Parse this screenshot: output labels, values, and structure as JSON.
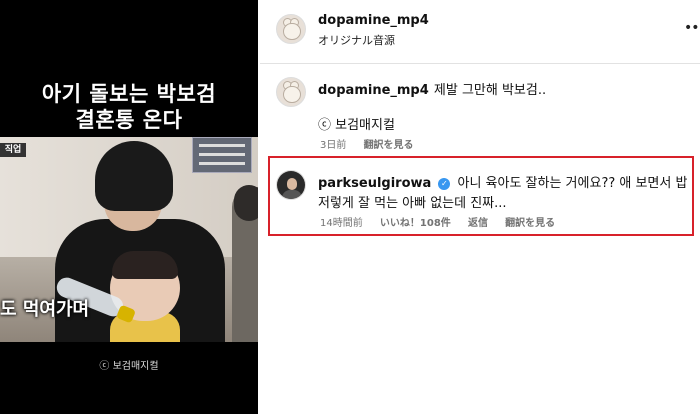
{
  "video": {
    "caption_line1": "아기 돌보는 박보검",
    "caption_line2": "결혼통 온다",
    "subtitle": "도 먹여가며",
    "watermark": "ⓒ 보검매지컬",
    "corner_badge": "직업"
  },
  "post": {
    "username": "dopamine_mp4",
    "audio": "オリジナル音源",
    "more_icon": "•••"
  },
  "comments": [
    {
      "username": "dopamine_mp4",
      "text": "제발 그만해 박보검..",
      "credit": "ⓒ 보검매지컬",
      "time": "3日前",
      "translate": "翻訳を見る"
    },
    {
      "username": "parkseulgirowa",
      "verified": true,
      "text_line1": "아니 육아도 잘하는 거에요?? 애 보면서 밥",
      "text_line2": "저렇게 잘 먹는 아빠 없는데 진짜...",
      "time": "14時間前",
      "likes": "いいね！108件",
      "reply": "返信",
      "translate": "翻訳を見る",
      "highlight_color": "#d8212a"
    }
  ]
}
